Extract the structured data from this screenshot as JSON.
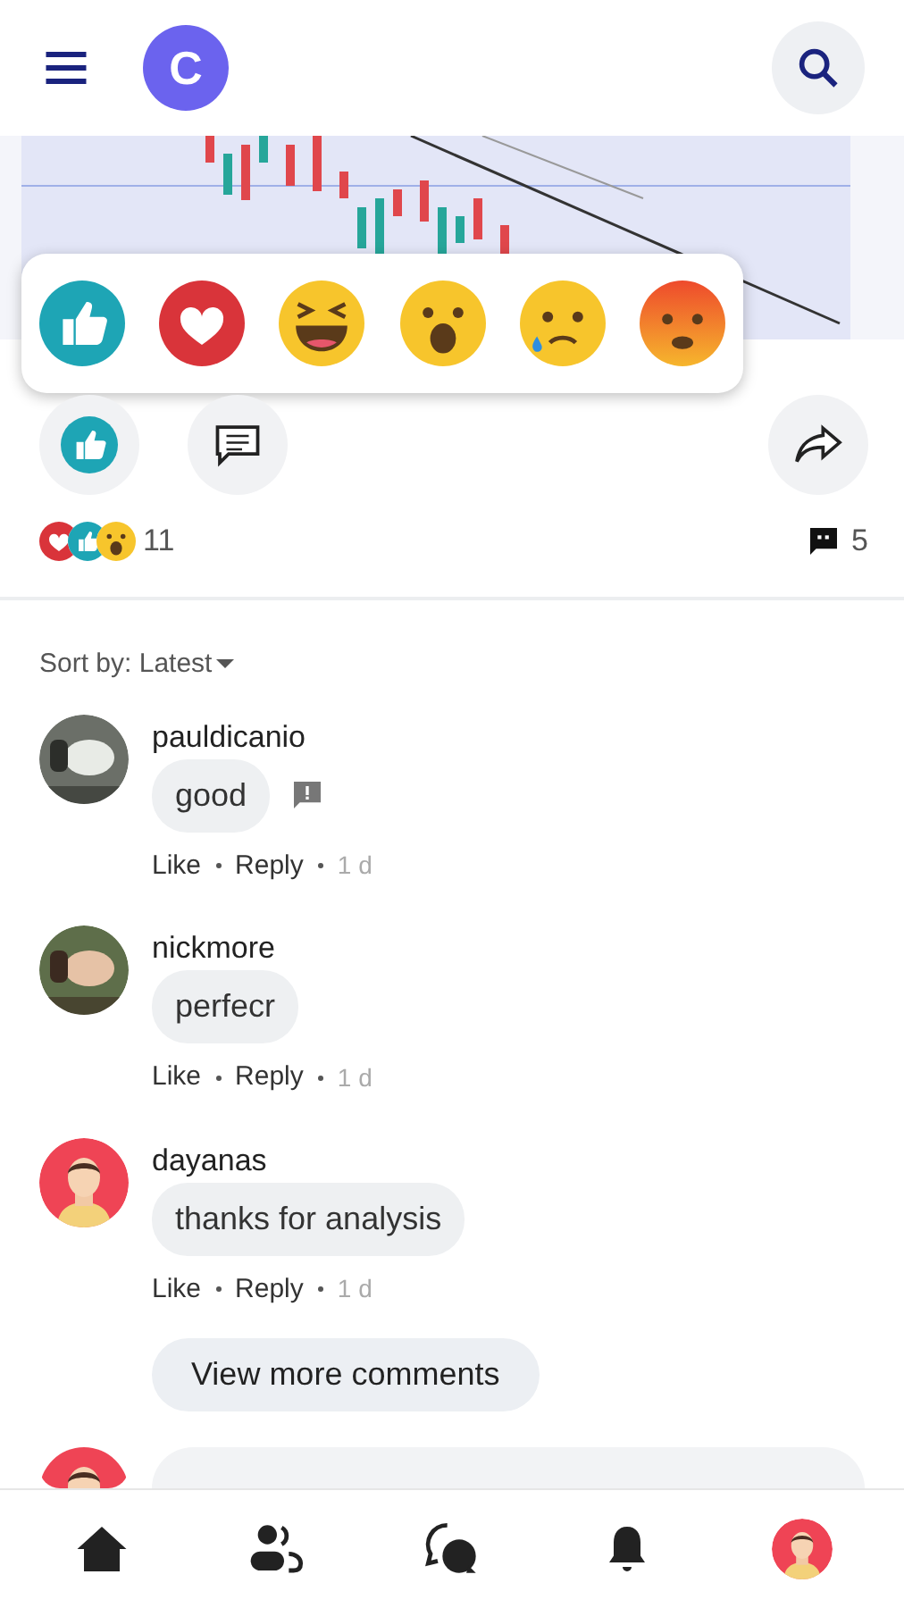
{
  "header": {
    "logo": "C"
  },
  "reaction_picker": [
    {
      "kind": "like"
    },
    {
      "kind": "love"
    },
    {
      "kind": "haha"
    },
    {
      "kind": "wow"
    },
    {
      "kind": "sad"
    },
    {
      "kind": "angry"
    }
  ],
  "actions": [
    {
      "kind": "like"
    },
    {
      "kind": "comment"
    },
    {
      "kind": "share"
    }
  ],
  "summary": {
    "reactions": [
      {
        "kind": "love"
      },
      {
        "kind": "like"
      },
      {
        "kind": "wow"
      }
    ],
    "reaction_count": "11",
    "comment_count": "5"
  },
  "sort": {
    "label": "Sort by:",
    "value": "Latest"
  },
  "comments": [
    {
      "user": "pauldicanio",
      "text": "good",
      "flag": true,
      "like": "Like",
      "reply": "Reply",
      "time": "1 d"
    },
    {
      "user": "nickmore",
      "text": "perfecr",
      "flag": false,
      "like": "Like",
      "reply": "Reply",
      "time": "1 d"
    },
    {
      "user": "dayanas",
      "avatar": {
        "kind": "illustration"
      },
      "text": "thanks for analysis",
      "flag": false,
      "like": "Like",
      "reply": "Reply",
      "time": "1 d"
    }
  ],
  "view_more": "View more comments",
  "bottom_nav": [
    {
      "kind": "home"
    },
    {
      "kind": "friends"
    },
    {
      "kind": "chat"
    },
    {
      "kind": "bell"
    },
    {
      "kind": "profile"
    }
  ]
}
